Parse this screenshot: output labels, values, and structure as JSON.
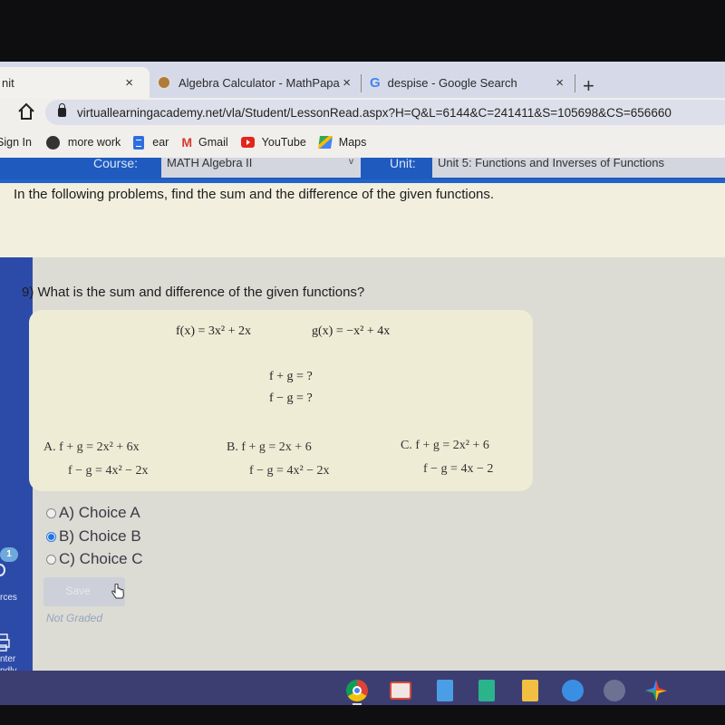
{
  "browser": {
    "tabs": [
      {
        "title": "nit",
        "active": true
      },
      {
        "title": "Algebra Calculator - MathPapa",
        "active": false
      },
      {
        "title": "despise - Google Search",
        "active": false
      }
    ],
    "close_glyph": "×",
    "new_tab_glyph": "+",
    "url": "virtuallearningacademy.net/vla/Student/LessonRead.aspx?H=Q&L=6144&C=241411&S=105698&CS=656660",
    "google_glyph": "G",
    "bookmarks": [
      {
        "label": "Sign In",
        "icon": "none"
      },
      {
        "label": "more work",
        "icon": "globe-icon"
      },
      {
        "label": "ear",
        "icon": "docs-icon"
      },
      {
        "label": "Gmail",
        "icon": "gmail-icon"
      },
      {
        "label": "YouTube",
        "icon": "youtube-icon"
      },
      {
        "label": "Maps",
        "icon": "maps-icon"
      }
    ],
    "gmail_glyph": "M"
  },
  "course_bar": {
    "course_label": "Course:",
    "course_value": "MATH Algebra II",
    "unit_label": "Unit:",
    "unit_value": "Unit 5: Functions and Inverses of Functions",
    "chevron": "v"
  },
  "instructions": "In the following problems, find the sum and the difference of the given functions.",
  "sidebar": {
    "badge_count": "1",
    "resources_label": "rces",
    "printer_label_1": "nter",
    "printer_label_2": "ndly"
  },
  "question": {
    "prompt": "9) What is the sum and difference of the given functions?",
    "f": "f(x) = 3x² + 2x",
    "g": "g(x) = −x² + 4x",
    "sum_prompt": "f + g = ?",
    "diff_prompt": "f − g = ?",
    "options": [
      {
        "letter": "A.",
        "sum": "f + g = 2x² + 6x",
        "diff": "f − g = 4x² − 2x"
      },
      {
        "letter": "B.",
        "sum": "f + g = 2x + 6",
        "diff": "f − g = 4x² − 2x"
      },
      {
        "letter": "C.",
        "sum": "f + g = 2x² + 6",
        "diff": "f − g = 4x − 2"
      }
    ]
  },
  "choices": [
    {
      "label": "A) Choice A",
      "selected": false
    },
    {
      "label": "B) Choice B",
      "selected": true
    },
    {
      "label": "C) Choice C",
      "selected": false
    }
  ],
  "save_label": "Save",
  "grade_status": "Not Graded",
  "shelf_apps": [
    "chrome-icon",
    "gmail-icon",
    "docs-icon",
    "sheets-icon",
    "slides-icon",
    "files-icon",
    "camera-icon",
    "photos-icon"
  ]
}
